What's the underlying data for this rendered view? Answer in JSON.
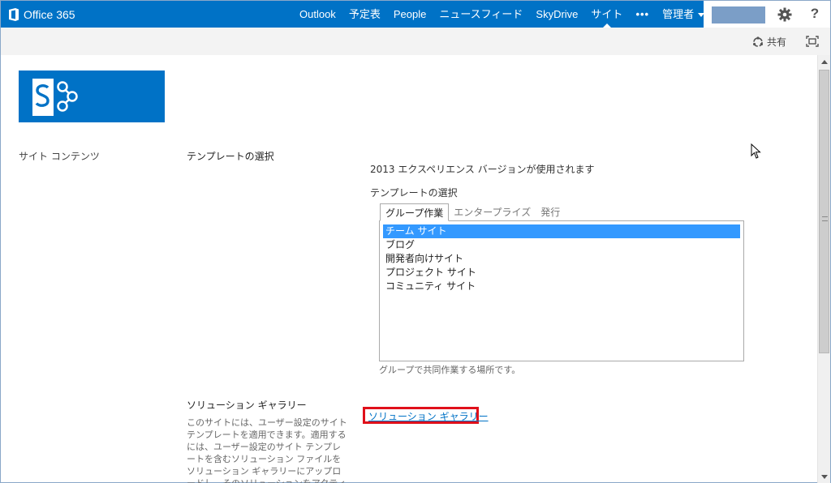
{
  "suitebar": {
    "brand": "Office 365",
    "nav": [
      {
        "label": "Outlook",
        "active": false
      },
      {
        "label": "予定表",
        "active": false
      },
      {
        "label": "People",
        "active": false
      },
      {
        "label": "ニュースフィード",
        "active": false
      },
      {
        "label": "SkyDrive",
        "active": false
      },
      {
        "label": "サイト",
        "active": true
      },
      {
        "label": "•••",
        "active": false
      },
      {
        "label": "管理者",
        "active": false
      }
    ],
    "help": "?",
    "icons": {
      "settings": "gear-icon",
      "help": "question-icon"
    }
  },
  "ribbon": {
    "share": "共有",
    "icons": {
      "share": "share-icon",
      "focus": "focus-mode-icon"
    }
  },
  "leftnav": {
    "item": "サイト コンテンツ"
  },
  "template_section": {
    "title": "テンプレートの選択",
    "experience_note": "2013 エクスペリエンス バージョンが使用されます",
    "selector_label": "テンプレートの選択",
    "tabs": [
      {
        "label": "グループ作業",
        "selected": true
      },
      {
        "label": "エンタープライズ",
        "selected": false
      },
      {
        "label": "発行",
        "selected": false
      }
    ],
    "options": [
      {
        "label": "チーム サイト",
        "selected": true
      },
      {
        "label": "ブログ",
        "selected": false
      },
      {
        "label": "開発者向けサイト",
        "selected": false
      },
      {
        "label": "プロジェクト サイト",
        "selected": false
      },
      {
        "label": "コミュニティ サイト",
        "selected": false
      }
    ],
    "description": "グループで共同作業する場所です。"
  },
  "solution_section": {
    "title": "ソリューション ギャラリー",
    "description": "このサイトには、ユーザー設定のサイト テンプレートを適用できます。適用するには、ユーザー設定のサイト テンプレートを含むソリューション ファイルをソリューション ギャラリーにアップロードし、そのソリューションをアクティブにして、[テンプレートの選択] セクションで",
    "link": "ソリューション ギャラリー"
  },
  "colors": {
    "suite_blue": "#0072c6",
    "selection_blue": "#3399ff",
    "highlight_red": "#e0101a",
    "user_box": "#7b9ec7"
  }
}
